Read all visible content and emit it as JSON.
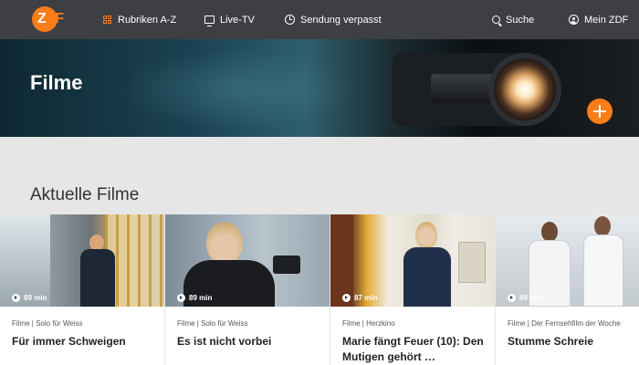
{
  "nav": {
    "logo_z": "Z",
    "logo_rest": "DF",
    "items": [
      {
        "label": "Rubriken A-Z",
        "icon": "grid-icon"
      },
      {
        "label": "Live-TV",
        "icon": "tv-icon"
      },
      {
        "label": "Sendung verpasst",
        "icon": "clock-icon"
      },
      {
        "label": "Suche",
        "icon": "search-icon"
      },
      {
        "label": "Mein ZDF",
        "icon": "user-icon"
      }
    ]
  },
  "hero": {
    "title": "Filme"
  },
  "section": {
    "title": "Aktuelle Filme"
  },
  "cards": [
    {
      "duration": "89 min",
      "category": "Filme | Solo für Weiss",
      "title": "Für immer Schweigen"
    },
    {
      "duration": "89 min",
      "category": "Filme | Solo für Weiss",
      "title": "Es ist nicht vorbei"
    },
    {
      "duration": "87 min",
      "category": "Filme | Herzkino",
      "title": "Marie fängt Feuer (10): Den Mutigen gehört …"
    },
    {
      "duration": "89 min",
      "category": "Filme | Der Fernsehfilm der Woche",
      "title": "Stumme Schreie"
    }
  ],
  "colors": {
    "accent": "#fa7d19",
    "nav_bg": "#3d3f43",
    "page_bg": "#e6e6e6"
  }
}
